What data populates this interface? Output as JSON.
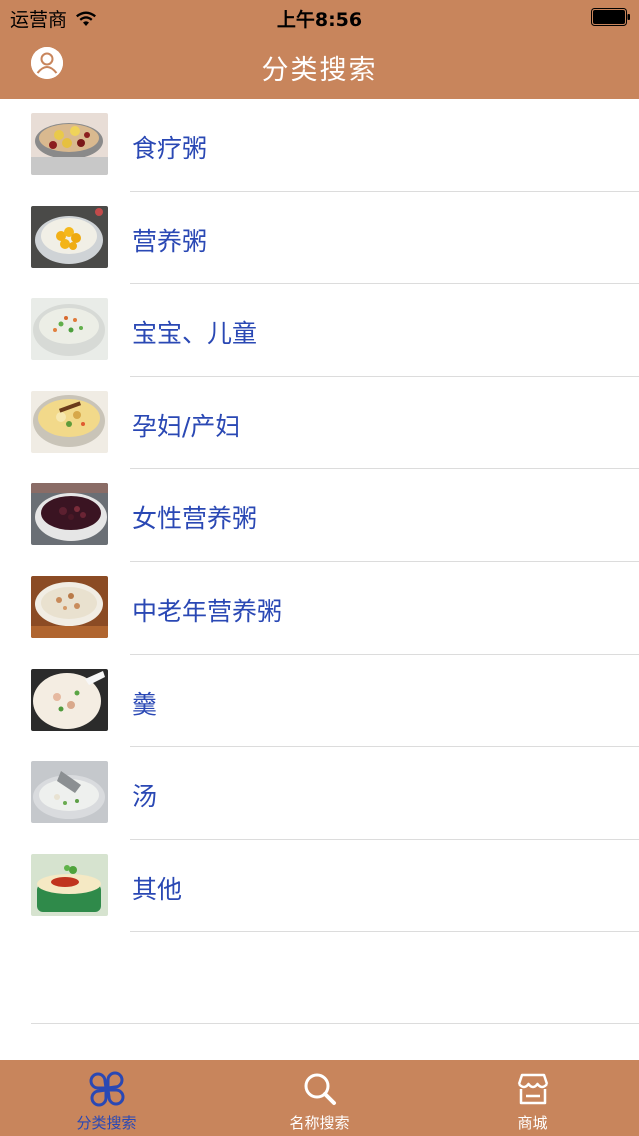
{
  "status_bar": {
    "carrier": "运营商",
    "time": "上午8:56"
  },
  "nav": {
    "title": "分类搜索"
  },
  "list": {
    "items": [
      {
        "label": "食疗粥",
        "icon": "porridge-red-dates-image"
      },
      {
        "label": "营养粥",
        "icon": "porridge-corn-image"
      },
      {
        "label": "宝宝、儿童",
        "icon": "porridge-vegetable-image"
      },
      {
        "label": "孕妇/产妇",
        "icon": "porridge-egg-image"
      },
      {
        "label": "女性营养粥",
        "icon": "porridge-black-rice-image"
      },
      {
        "label": "中老年营养粥",
        "icon": "porridge-meat-image"
      },
      {
        "label": "羹",
        "icon": "thick-soup-image"
      },
      {
        "label": "汤",
        "icon": "soup-image"
      },
      {
        "label": "其他",
        "icon": "custard-image"
      }
    ]
  },
  "tabbar": {
    "tabs": [
      {
        "label": "分类搜索",
        "icon": "clover-icon",
        "active": true
      },
      {
        "label": "名称搜索",
        "icon": "search-icon",
        "active": false
      },
      {
        "label": "商城",
        "icon": "store-icon",
        "active": false
      }
    ]
  },
  "colors": {
    "bar_background": "#c8855c",
    "label_text": "#2a48b4",
    "active_tab": "#2a48b4",
    "separator": "#dcdcdc"
  }
}
